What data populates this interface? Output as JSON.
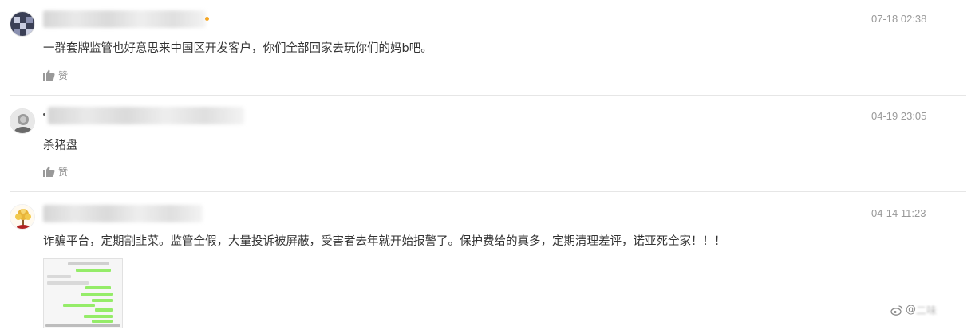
{
  "comments": [
    {
      "time": "07-18 02:38",
      "text": "一群套牌监管也好意思来中国区开发客户，你们全部回家去玩你们的妈b吧。",
      "like_label": "赞"
    },
    {
      "time": "04-19 23:05",
      "text": "杀猪盘",
      "like_label": "赞"
    },
    {
      "time": "04-14 11:23",
      "text": "诈骗平台，定期割韭菜。监管全假，大量投诉被屏蔽，受害者去年就开始报警了。保护费给的真多，定期清理差评，诺亚死全家！！！"
    }
  ],
  "watermark": {
    "at": "@",
    "text": "二味"
  },
  "colors": {
    "time": "#999999",
    "text": "#333333",
    "divider": "#e6e6e6",
    "chat_green": "#95ec69"
  },
  "icons": {
    "like": "thumbs-up-icon",
    "watermark": "weibo-logo-icon"
  }
}
